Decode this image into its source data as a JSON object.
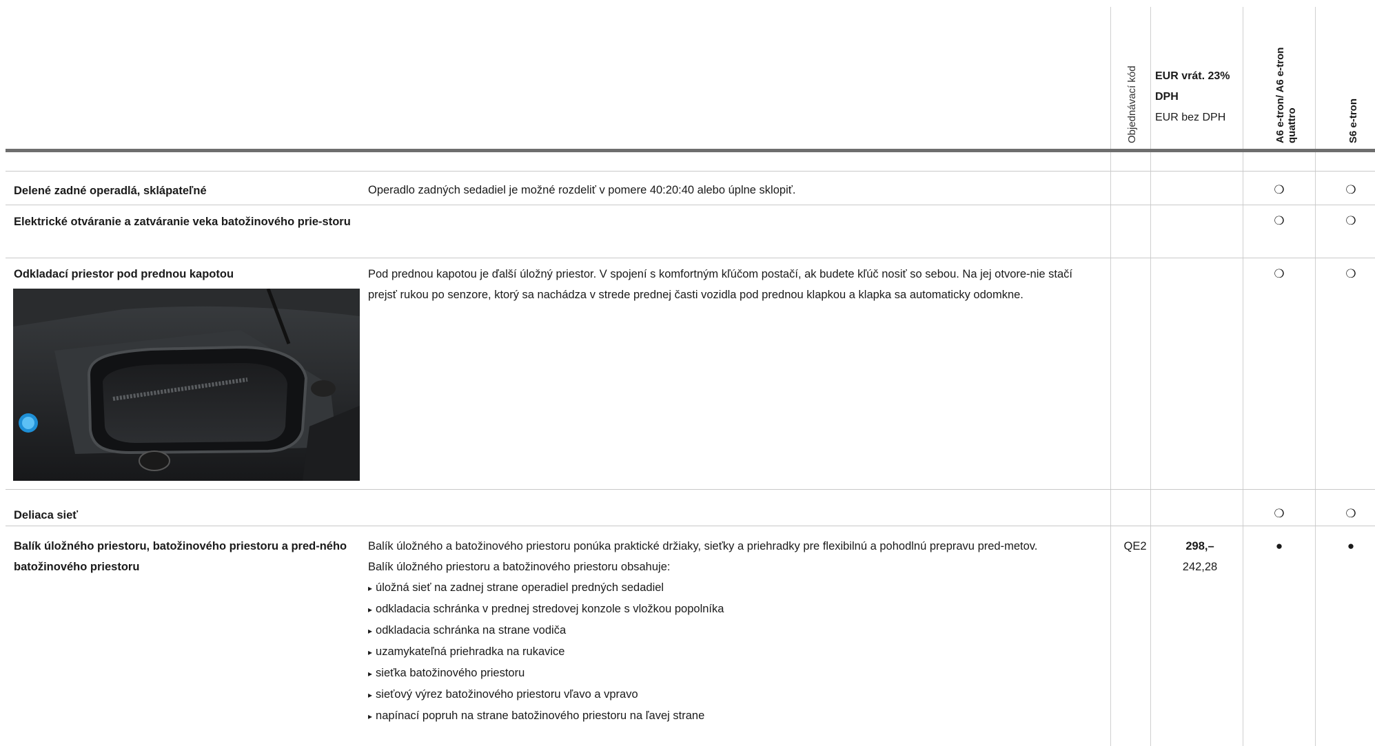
{
  "header": {
    "order_code": "Objednávací kód",
    "price_gross": "EUR vrát. 23% DPH",
    "price_net": "EUR bez DPH",
    "model1": "A6 e-tron/ A6 e-tron quattro",
    "model2": "S6 e-tron"
  },
  "rows": [
    {
      "title": "Delené zadné operadlá, sklápateľné",
      "desc": "Operadlo zadných sedadiel je možné rozdeliť v pomere 40:20:40 alebo úplne sklopiť.",
      "m1": "❍",
      "m2": "❍"
    },
    {
      "title": "Elektrické otváranie a zatváranie veka batožinového prie-storu",
      "desc": "",
      "m1": "❍",
      "m2": "❍"
    },
    {
      "title": "Odkladací priestor pod prednou kapotou",
      "desc": "Pod prednou kapotou je ďalší úložný priestor. V spojení s komfortným kľúčom postačí, ak budete kľúč nosiť so sebou. Na jej otvore-nie stačí prejsť rukou po senzore, ktorý sa nachádza v strede prednej časti vozidla pod prednou klapkou a klapka sa automaticky odomkne.",
      "m1": "❍",
      "m2": "❍"
    },
    {
      "title": "Deliaca sieť",
      "desc": "",
      "m1": "❍",
      "m2": "❍"
    },
    {
      "title": "Balík úložného priestoru, batožinového priestoru a pred-ného batožinového priestoru",
      "desc": "Balík úložného a batožinového priestoru ponúka praktické držiaky, sieťky a priehradky pre flexibilnú a pohodlnú prepravu pred-metov.",
      "intro": "Balík úložného priestoru a batožinového priestoru obsahuje:",
      "items": [
        "úložná sieť na zadnej strane operadiel predných sedadiel",
        "odkladacia schránka v prednej stredovej konzole s vložkou popolníka",
        "odkladacia schránka na strane vodiča",
        "uzamykateľná priehradka na rukavice",
        "sieťka batožinového priestoru",
        "sieťový výrez batožinového priestoru vľavo a vpravo",
        "napínací popruh na strane batožinového priestoru na ľavej strane"
      ],
      "code": "QE2",
      "price_gross": "298,–",
      "price_net": "242,28",
      "m1": "●",
      "m2": "●"
    }
  ]
}
